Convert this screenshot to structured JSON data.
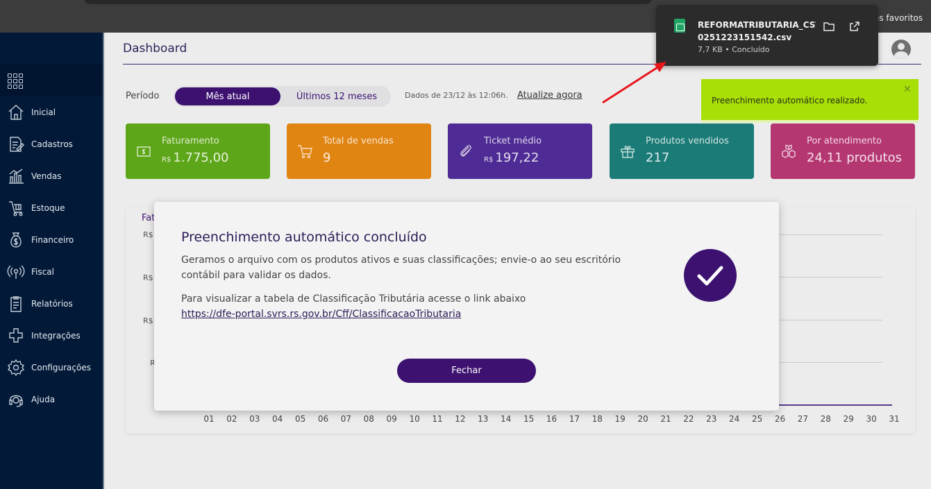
{
  "browser": {
    "bookmarks_label": "os favoritos"
  },
  "sidebar": {
    "items": [
      {
        "label": "Inicial",
        "icon": "house-icon"
      },
      {
        "label": "Cadastros",
        "icon": "document-edit-icon"
      },
      {
        "label": "Vendas",
        "icon": "bar-chart-icon"
      },
      {
        "label": "Estoque",
        "icon": "cart-dolly-icon"
      },
      {
        "label": "Financeiro",
        "icon": "money-bag-icon"
      },
      {
        "label": "Fiscal",
        "icon": "broadcast-icon"
      },
      {
        "label": "Relatórios",
        "icon": "clipboard-icon"
      },
      {
        "label": "Integrações",
        "icon": "plug-icon"
      },
      {
        "label": "Configurações",
        "icon": "gear-icon"
      },
      {
        "label": "Ajuda",
        "icon": "headset-icon"
      }
    ]
  },
  "header": {
    "title": "Dashboard"
  },
  "period": {
    "label": "Período",
    "active": "Mês atual",
    "other": "Últimos 12 meses",
    "updated_text": "Dados de 23/12 às 12:06h.",
    "update_link": "Atualize agora"
  },
  "cards": [
    {
      "title": "Faturamento",
      "prefix": "R$",
      "value": "1.775,00",
      "color": "#5ea619"
    },
    {
      "title": "Total de vendas",
      "prefix": "",
      "value": "9",
      "color": "#e08412"
    },
    {
      "title": "Ticket médio",
      "prefix": "R$",
      "value": "197,22",
      "color": "#4f2c95"
    },
    {
      "title": "Produtos vendidos",
      "prefix": "",
      "value": "217",
      "color": "#1b7b77"
    },
    {
      "title": "Por atendimento",
      "prefix": "",
      "value": "24,11 produtos",
      "color": "#b53772"
    }
  ],
  "chart_data": {
    "type": "line",
    "title": "Fat",
    "y_tick_labels": [
      "R$",
      "R$",
      "R$",
      "R"
    ],
    "categories": [
      "01",
      "02",
      "03",
      "04",
      "05",
      "06",
      "07",
      "08",
      "09",
      "10",
      "11",
      "12",
      "13",
      "14",
      "15",
      "16",
      "17",
      "18",
      "19",
      "20",
      "21",
      "22",
      "23",
      "24",
      "25",
      "26",
      "27",
      "28",
      "29",
      "30",
      "31"
    ]
  },
  "modal": {
    "title": "Preenchimento automático concluído",
    "text1": "Geramos o arquivo com os produtos ativos e suas classificações; envie-o ao seu escritório contábil para validar os dados.",
    "text2": "Para visualizar a tabela de Classificação Tributária acesse o link abaixo",
    "link": "https://dfe-portal.svrs.rs.gov.br/Cff/ClassificacaoTributaria",
    "button": "Fechar"
  },
  "download": {
    "filename_line1": "REFORMATRIBUTARIA_CSTCI",
    "filename_line2": "0251223151542.csv",
    "status": "7,7 KB • Concluído"
  },
  "toast": {
    "text": "Preenchimento automático realizado.",
    "close": "✕"
  }
}
